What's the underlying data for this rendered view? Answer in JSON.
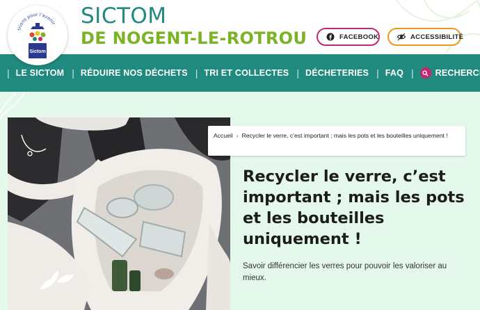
{
  "header": {
    "title": "SICTOM",
    "subtitle": "DE NOGENT-LE-ROTROU",
    "logo": {
      "tagline": "trions pour l'avenir",
      "label": "Sictom"
    },
    "facebook_label": "FACEBOOK",
    "accessibility_label": "ACCESSIBILITÉ",
    "colors": {
      "teal": "#1f8a7d",
      "green": "#7bb324",
      "magenta": "#c4276f",
      "orange": "#e89a19"
    }
  },
  "nav": {
    "items": [
      {
        "label": "LE SICTOM"
      },
      {
        "label": "RÉDUIRE NOS DÉCHETS"
      },
      {
        "label": "TRI ET COLLECTES"
      },
      {
        "label": "DÉCHETERIES"
      },
      {
        "label": "FAQ"
      }
    ],
    "search_label": "RECHERCHER",
    "search_icon": "search-icon"
  },
  "article": {
    "breadcrumb": {
      "home": "Accueil",
      "current": "Recycler le verre, c’est important ; mais les pots et les bouteilles uniquement !"
    },
    "title": "Recycler le verre, c’est important ; mais les pots et les bouteilles uniquement !",
    "lead": "Savoir différencier les verres pour pouvoir les valoriser au mieux.",
    "background": "#e4f8ec"
  }
}
